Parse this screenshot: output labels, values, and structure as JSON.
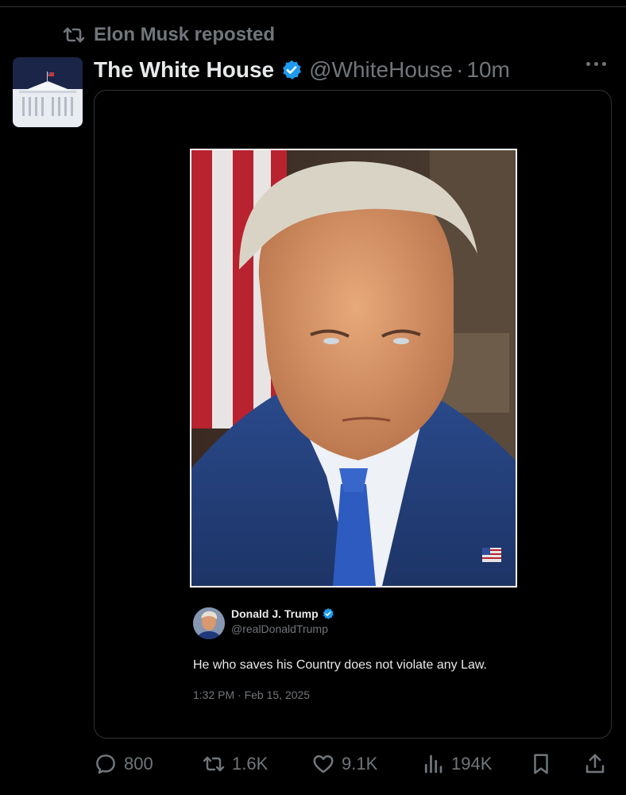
{
  "repost": {
    "label": "Elon Musk reposted"
  },
  "post": {
    "author_name": "The White House",
    "author_handle": "@WhiteHouse",
    "separator": "·",
    "time": "10m"
  },
  "quoted_post": {
    "author_name": "Donald J. Trump",
    "author_handle": "@realDonaldTrump",
    "text": "He who saves his Country does not violate any Law.",
    "timestamp": "1:32 PM · Feb 15, 2025"
  },
  "actions": {
    "replies": "800",
    "reposts": "1.6K",
    "likes": "9.1K",
    "views": "194K"
  },
  "colors": {
    "background": "#000000",
    "text_primary": "#e7e9ea",
    "text_secondary": "#71767b",
    "verified": "#1d9bf0",
    "border": "#2f3336"
  },
  "icons": {
    "repost": "repost-icon",
    "verified": "verified-badge-icon",
    "more": "more-icon",
    "reply": "reply-icon",
    "like": "heart-icon",
    "views": "views-icon",
    "bookmark": "bookmark-icon",
    "share": "share-icon"
  }
}
